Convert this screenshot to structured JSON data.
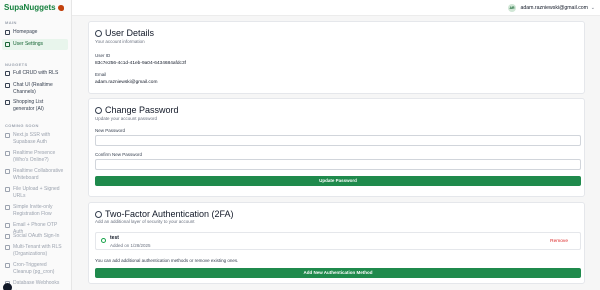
{
  "app": {
    "brand": "SupaNuggets"
  },
  "sidebar": {
    "main_heading": "MAIN",
    "main_items": [
      {
        "label": "Homepage"
      },
      {
        "label": "User Settings"
      }
    ],
    "nuggets_heading": "NUGGETS",
    "nugget_items": [
      {
        "label": "Full CRUD with RLS"
      },
      {
        "label": "Chat UI (Realtime Channels)"
      },
      {
        "label": "Shopping List generator (AI)"
      }
    ],
    "coming_soon_heading": "COMING SOON",
    "coming_items": [
      {
        "label": "Next.js SSR with Supabase Auth"
      },
      {
        "label": "Realtime Presence (Who's Online?)"
      },
      {
        "label": "Realtime Collaborative Whiteboard"
      },
      {
        "label": "File Upload + Signed URLs"
      },
      {
        "label": "Simple Invite-only Registration Flow"
      },
      {
        "label": "Email + Phone OTP Auth"
      },
      {
        "label": "Social OAuth Sign-In"
      },
      {
        "label": "Multi-Tenant with RLS (Organizations)"
      },
      {
        "label": "Cron-Triggered Cleanup (pg_cron)"
      },
      {
        "label": "Database Webhooks →"
      }
    ]
  },
  "header": {
    "avatar_initials": "AR",
    "email": "adam.razniewski@gmail.com"
  },
  "user_details": {
    "title": "User Details",
    "subtitle": "Your account information",
    "user_id_label": "User ID",
    "user_id_value": "83c7e256-4c1d-41eb-9a04-6434684afdc3f",
    "email_label": "Email",
    "email_value": "adam.razniewski@gmail.com"
  },
  "change_password": {
    "title": "Change Password",
    "subtitle": "Update your account password",
    "new_password_label": "New Password",
    "confirm_password_label": "Confirm New Password",
    "button_label": "Update Password"
  },
  "two_factor": {
    "title": "Two-Factor Authentication (2FA)",
    "subtitle": "Add an additional layer of security to your account",
    "method_name": "test",
    "method_added": "Added on 1/28/2025",
    "remove_label": "Remove",
    "hint": "You can add additional authentication methods or remove existing ones.",
    "add_button_label": "Add New Authentication Method"
  },
  "colors": {
    "brand": "#15803d",
    "primary_button": "#1f8a4c",
    "danger": "#dc2626",
    "active_bg": "#e8f5ec"
  },
  "icons": {
    "user_details": "user-icon",
    "change_password": "key-icon",
    "two_factor": "shield-key-icon",
    "method_status": "check-circle-icon"
  }
}
